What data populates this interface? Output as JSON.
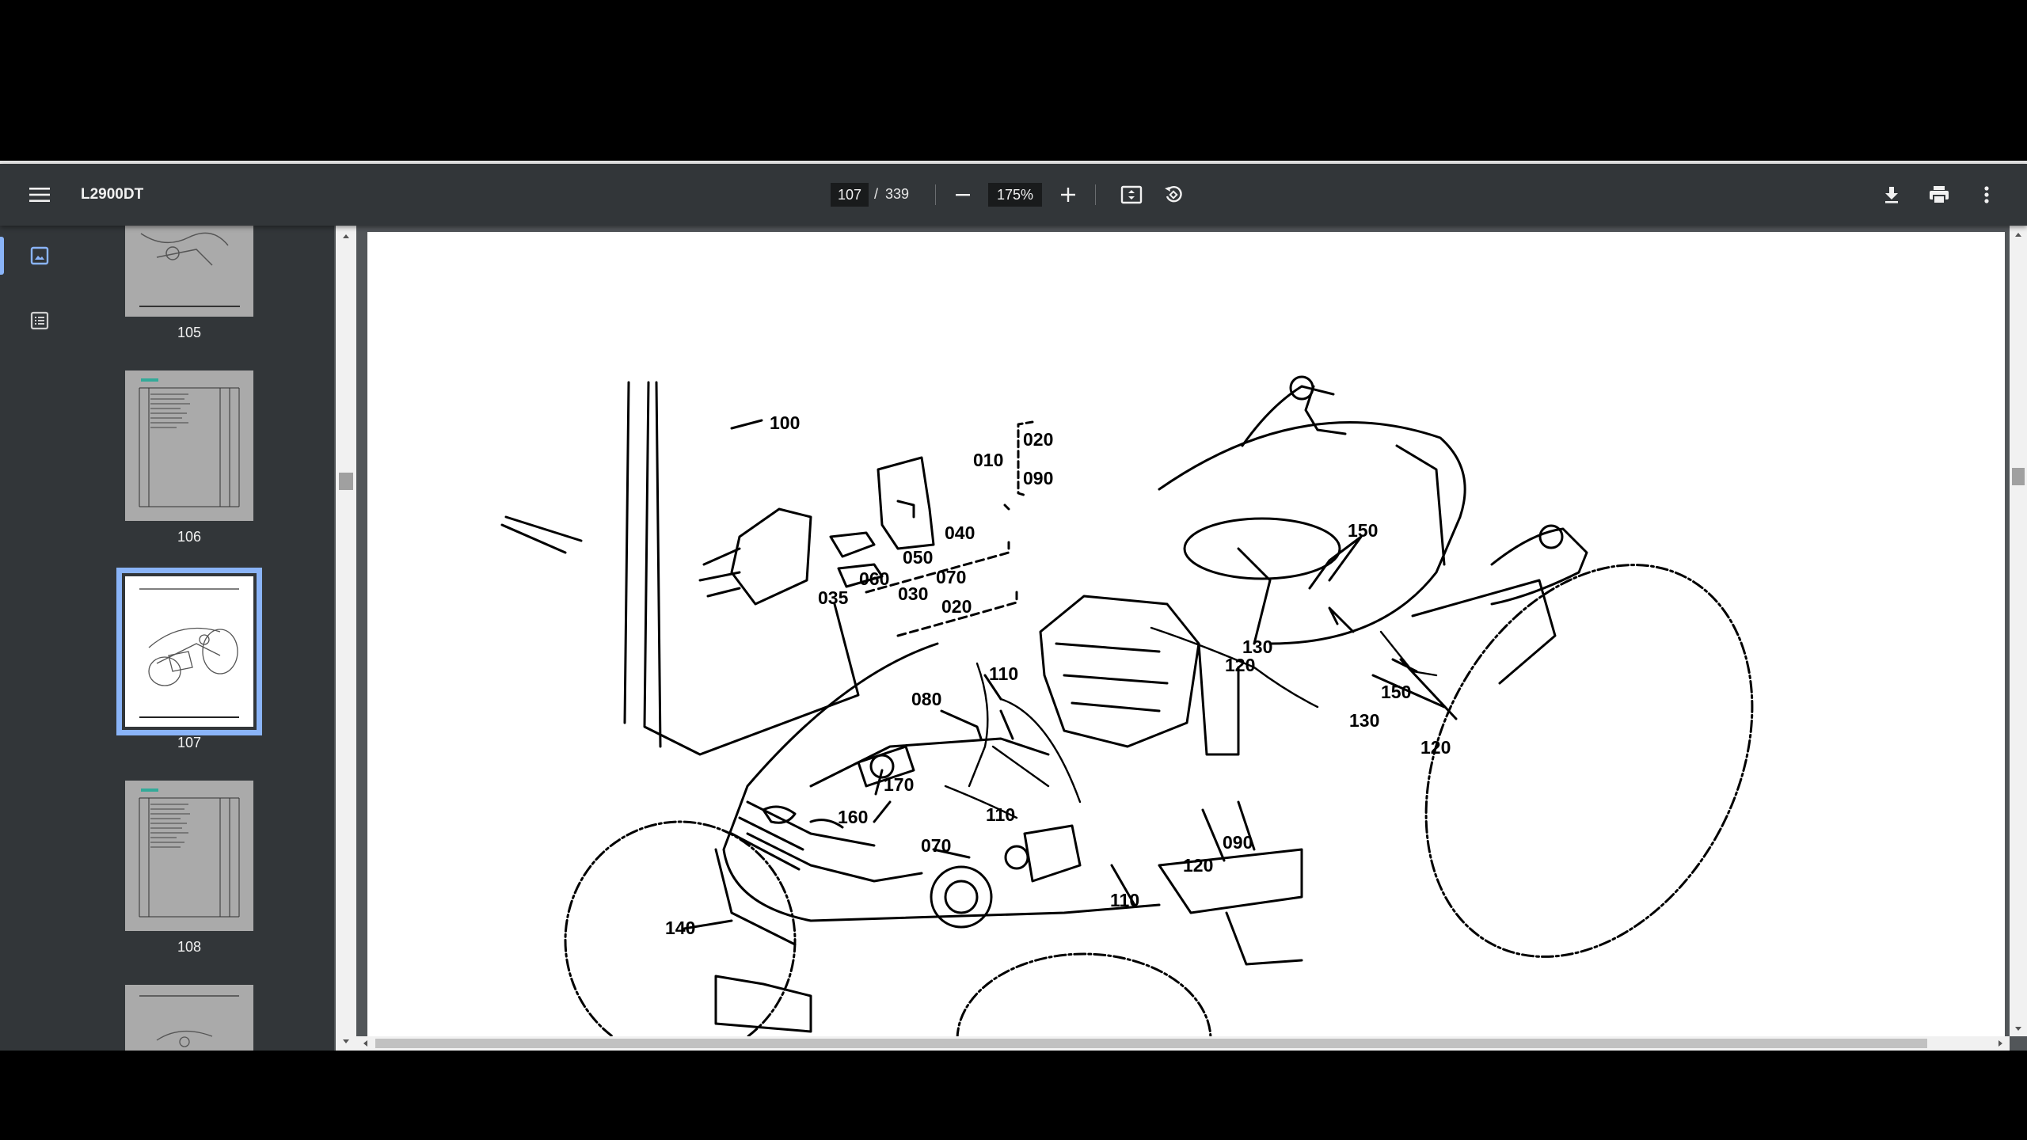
{
  "toolbar": {
    "title": "L2900DT",
    "current_page": "107",
    "page_separator": "/",
    "total_pages": "339",
    "zoom_level": "175%",
    "icons": [
      "menu-icon",
      "zoom-out-icon",
      "zoom-in-icon",
      "fit-page-icon",
      "rotate-icon",
      "download-icon",
      "print-icon",
      "more-vert-icon"
    ]
  },
  "sidebar": {
    "tabs": [
      {
        "name": "thumbnails",
        "icon": "image-icon",
        "active": true
      },
      {
        "name": "outline",
        "icon": "list-icon",
        "active": false
      }
    ],
    "thumbnails": [
      {
        "label": "105"
      },
      {
        "label": "106"
      },
      {
        "label": "107",
        "selected": true
      },
      {
        "label": "108"
      }
    ]
  },
  "diagram": {
    "callouts": [
      "100",
      "010",
      "020",
      "090",
      "040",
      "050",
      "060",
      "070",
      "030",
      "020",
      "035",
      "150",
      "130",
      "120",
      "150",
      "130",
      "120",
      "110",
      "080",
      "170",
      "160",
      "110",
      "070",
      "120",
      "090",
      "110",
      "140"
    ]
  },
  "colors": {
    "toolbar_bg": "#323639",
    "viewer_bg": "#525659",
    "accent": "#8ab4f8"
  }
}
